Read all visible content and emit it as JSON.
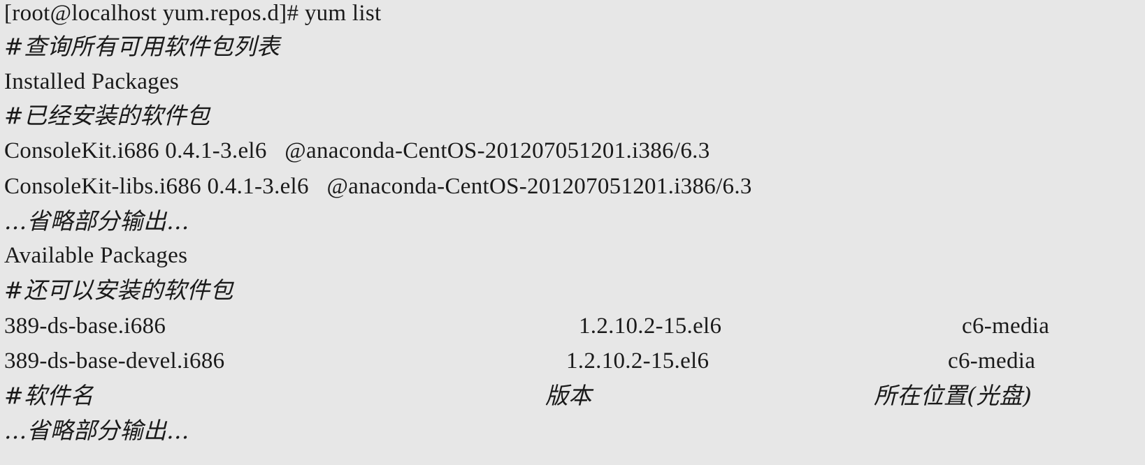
{
  "terminal": {
    "command_line": "[root@localhost yum.repos.d]# yum list",
    "comment_list_all": "#查询所有可用软件包列表",
    "installed_header": "Installed Packages",
    "comment_installed": "#已经安装的软件包",
    "installed_rows": [
      "ConsoleKit.i686 0.4.1-3.el6   @anaconda-CentOS-201207051201.i386/6.3",
      "ConsoleKit-libs.i686 0.4.1-3.el6   @anaconda-CentOS-201207051201.i386/6.3"
    ],
    "omitted_1": "...省略部分输出...",
    "available_header": "Available Packages",
    "comment_available": "#还可以安装的软件包",
    "available_rows": [
      {
        "name": "389-ds-base.i686",
        "version": "1.2.10.2-15.el6",
        "repo": "c6-media"
      },
      {
        "name": "389-ds-base-devel.i686",
        "version": "1.2.10.2-15.el6",
        "repo": "c6-media"
      }
    ],
    "legend": {
      "name": "#软件名",
      "version": "版本",
      "location": "所在位置(光盘)"
    },
    "omitted_2": "...省略部分输出..."
  }
}
